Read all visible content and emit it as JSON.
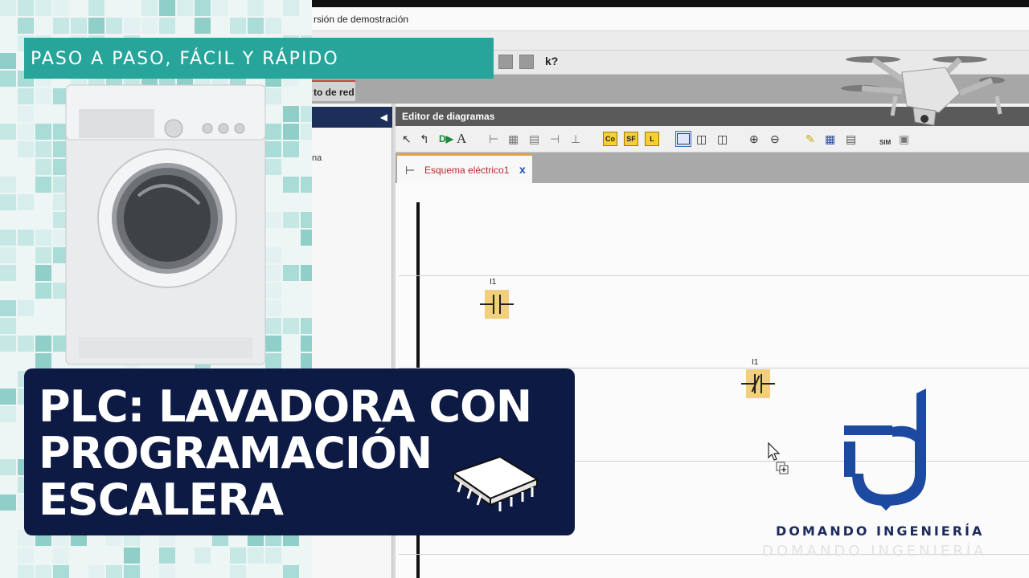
{
  "banner": {
    "text": "PASO A PASO, FÁCIL Y RÁPIDO"
  },
  "title": {
    "line1": "PLC: LAVADORA CON",
    "line2": "PROGRAMACIÓN",
    "line3": "ESCALERA"
  },
  "app": {
    "window_title": "rsión de demostración",
    "help_button": "k?",
    "tab_partial": "to de red",
    "left_panel_item": "na",
    "editor_title": "Editor de diagramas",
    "toolbar": {
      "co_label": "Co",
      "sf_label": "SF",
      "l_label": "L",
      "sim_label": "SIM",
      "text_tool": "A"
    },
    "document_tab": {
      "label": "Esquema eléctrico1",
      "close": "x"
    },
    "diagram": {
      "contacts": [
        {
          "label": "I1",
          "type": "normally-open"
        },
        {
          "label": "I1",
          "type": "normally-closed"
        }
      ]
    }
  },
  "brand": {
    "name": "DOMANDO INGENIERÍA",
    "ghost_name": "DOMANDO INGENIERÍA"
  },
  "colors": {
    "banner": "#27a59a",
    "card": "#0d1a44",
    "accent": "#f6cf34",
    "logo_blue": "#1c4aa0",
    "logo_dark": "#1c2b5e"
  },
  "icons": [
    "cursor-arrow-icon",
    "pin-icon",
    "coil-tool-icon",
    "text-tool-icon",
    "zoom-in-icon",
    "zoom-out-icon",
    "highlighter-icon",
    "grid-icon",
    "simulation-icon",
    "chip-icon",
    "drone-image",
    "washing-machine-image"
  ]
}
